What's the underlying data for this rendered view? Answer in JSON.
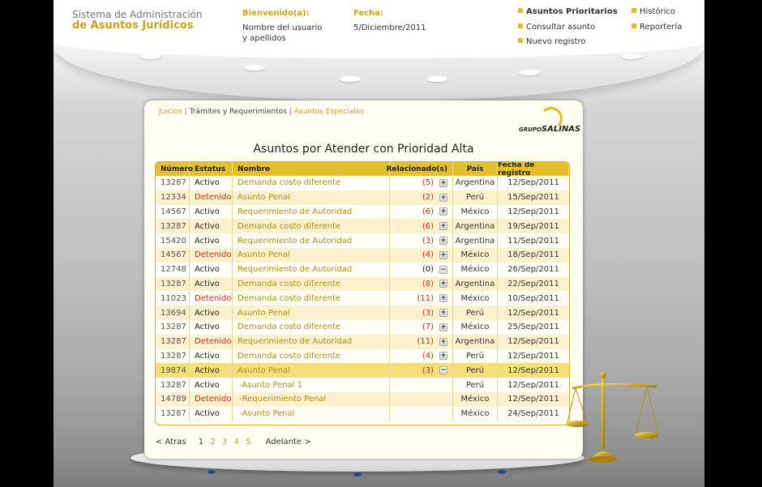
{
  "header": {
    "app_title_1": "Sistema de Administración",
    "app_title_2": "de Asuntos Jurídicos",
    "welcome_label": "Bienvenido(a):",
    "user_name_1": "Nombre del usuario",
    "user_name_2": "y apellidos",
    "date_label": "Fecha:",
    "date_value": "5/Diciembre/2011"
  },
  "topnav": {
    "priority": "Asuntos Prioritarios",
    "consult": "Consultar asunto",
    "new": "Nuevo registro",
    "history": "Histórico",
    "reports": "Reportería"
  },
  "breadcrumb": {
    "item1": "Juicios",
    "item2": "Trámites y Requerimientos",
    "item3": "Asuntos Especiales"
  },
  "logo": {
    "small": "GRUPO",
    "big": "SALINAS"
  },
  "page_title": "Asuntos por Atender con Prioridad Alta",
  "table": {
    "headers": {
      "numero": "Número",
      "estatus": "Estatus",
      "nombre": "Nombre",
      "relacionado": "Relacionado(s)",
      "pais": "País",
      "fecha": "Fecha de registro"
    },
    "rows": [
      {
        "numero": "13287",
        "estatus": "Activo",
        "nombre": "Demanda costo diferente",
        "rel": "(5)",
        "toggle": "+",
        "pais": "Argentina",
        "fecha": "12/Sep/2011"
      },
      {
        "numero": "12334",
        "estatus": "Detenido",
        "nombre": "Asunto Penal",
        "rel": "(2)",
        "toggle": "+",
        "pais": "Perú",
        "fecha": "15/Sep/2011"
      },
      {
        "numero": "14567",
        "estatus": "Activo",
        "nombre": "Requerimiento de Autoridad",
        "rel": "(6)",
        "toggle": "+",
        "pais": "México",
        "fecha": "12/Sep/2011"
      },
      {
        "numero": "13287",
        "estatus": "Activo",
        "nombre": "Demanda costo diferente",
        "rel": "(6)",
        "toggle": "+",
        "pais": "Argentina",
        "fecha": "19/Sep/2011"
      },
      {
        "numero": "15420",
        "estatus": "Activo",
        "nombre": "Requerimiento de Autoridad",
        "rel": "(3)",
        "toggle": "+",
        "pais": "Argentina",
        "fecha": "11/Sep/2011"
      },
      {
        "numero": "14567",
        "estatus": "Detenido",
        "nombre": "Asunto Penal",
        "rel": "(4)",
        "toggle": "+",
        "pais": "México",
        "fecha": "18/Sep/2011"
      },
      {
        "numero": "12748",
        "estatus": "Activo",
        "nombre": "Requerimiento de Autoridad",
        "rel": "(0)",
        "toggle": "−",
        "pais": "México",
        "fecha": "26/Sep/2011"
      },
      {
        "numero": "13287",
        "estatus": "Activo",
        "nombre": "Demanda costo diferente",
        "rel": "(8)",
        "toggle": "+",
        "pais": "Argentina",
        "fecha": "22/Sep/2011"
      },
      {
        "numero": "11023",
        "estatus": "Detenido",
        "nombre": "Demanda costo diferente",
        "rel": "(11)",
        "toggle": "+",
        "pais": "México",
        "fecha": "10/Sep/2011"
      },
      {
        "numero": "13694",
        "estatus": "Activo",
        "nombre": "Asunto Penal",
        "rel": "(3)",
        "toggle": "+",
        "pais": "Perú",
        "fecha": "12/Sep/2011"
      },
      {
        "numero": "13287",
        "estatus": "Activo",
        "nombre": "Demanda costo diferente",
        "rel": "(7)",
        "toggle": "+",
        "pais": "México",
        "fecha": "25/Sep/2011"
      },
      {
        "numero": "13287",
        "estatus": "Detenido",
        "nombre": "Requerimiento de Autoridad",
        "rel": "(11)",
        "toggle": "+",
        "pais": "Argentina",
        "fecha": "12/Sep/2011"
      },
      {
        "numero": "13287",
        "estatus": "Activo",
        "nombre": "Demanda costo diferente",
        "rel": "(4)",
        "toggle": "+",
        "pais": "Perú",
        "fecha": "12/Sep/2011"
      },
      {
        "numero": "19874",
        "estatus": "Activo",
        "nombre": "Asunto Penal",
        "rel": "(3)",
        "toggle": "−",
        "pais": "Perú",
        "fecha": "12/Sep/2011"
      },
      {
        "numero": "13287",
        "estatus": "Activo",
        "nombre": "-Asunto Penal 1",
        "rel": "",
        "toggle": "",
        "pais": "Perú",
        "fecha": "12/Sep/2011"
      },
      {
        "numero": "14789",
        "estatus": "Detenido",
        "nombre": "-Requerimiento Penal",
        "rel": "",
        "toggle": "",
        "pais": "México",
        "fecha": "12/Sep/2011"
      },
      {
        "numero": "13287",
        "estatus": "Activo",
        "nombre": "-Asunto Penal",
        "rel": "",
        "toggle": "",
        "pais": "México",
        "fecha": "24/Sep/2011"
      }
    ]
  },
  "pager": {
    "prev": "< Atras",
    "pages": [
      "1",
      "2",
      "3",
      "4",
      "5"
    ],
    "next": "Adelante >"
  },
  "colors": {
    "accent": "#e2c12c",
    "text_gold": "#c9a31c",
    "status_red": "#cc2a1c"
  }
}
